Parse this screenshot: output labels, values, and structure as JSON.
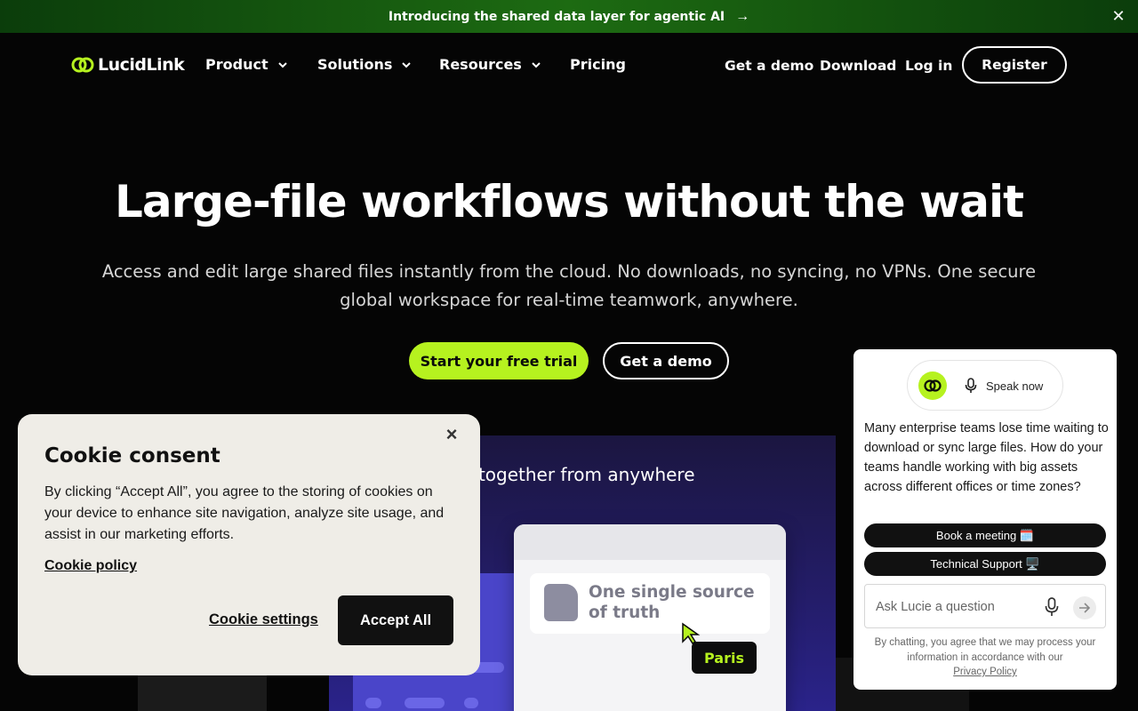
{
  "announcement": {
    "text": "Introducing the shared data layer for agentic AI",
    "arrow": "→",
    "close": "✕"
  },
  "nav": {
    "logo_text": "LucidLink",
    "items": [
      {
        "label": "Product",
        "dropdown": true
      },
      {
        "label": "Solutions",
        "dropdown": true
      },
      {
        "label": "Resources",
        "dropdown": true
      },
      {
        "label": "Pricing",
        "dropdown": false
      }
    ],
    "right": {
      "demo": "Get a demo",
      "download": "Download",
      "login": "Log in",
      "register": "Register"
    }
  },
  "hero": {
    "title": "Large-file workflows without the wait",
    "subtitle": "Access and edit large shared files instantly from the cloud. No downloads, no syncing, no VPNs. One secure global workspace for real-time teamwork, anywhere.",
    "cta_primary": "Start your free trial",
    "cta_secondary": "Get a demo"
  },
  "visual": {
    "caption": "k together from anywhere",
    "card_text": "One single source of truth",
    "tag": "Paris"
  },
  "cookie": {
    "title": "Cookie consent",
    "body": "By clicking “Accept All”, you agree to the storing of cookies on your device to enhance site navigation, analyze site usage, and assist in our marketing efforts.",
    "policy_link": "Cookie policy",
    "settings": "Cookie settings",
    "accept": "Accept All",
    "close": "×"
  },
  "chat": {
    "speak": "Speak now",
    "message": "Many enterprise teams lose time waiting to download or sync large files. How do your teams handle working with big assets across different offices or time zones?",
    "chips": [
      "Book a meeting 🗓️",
      "Technical Support 🖥️"
    ],
    "input_placeholder": "Ask Lucie a question",
    "disclaimer": "By chatting, you agree that we may process your information in accordance with our",
    "privacy_link": "Privacy Policy"
  },
  "colors": {
    "accent": "#b6f21f",
    "background": "#050505",
    "banner_green": "#1d6b12"
  }
}
